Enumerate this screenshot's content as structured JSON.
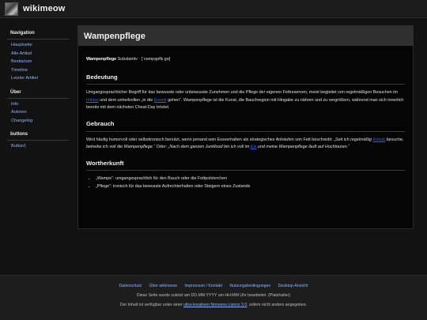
{
  "header": {
    "logo_icon": "cat-logo-icon",
    "site_name": "wikimeow"
  },
  "sidebar": {
    "nav_heading": "Navigation",
    "nav_items": [
      "Hauptseite",
      "Alle Artikel",
      "Bestiarium",
      "Timeline",
      "Letzter Artikel"
    ],
    "about_heading": "Über",
    "about_items": [
      "Info",
      "Autoren",
      "Changelog"
    ],
    "buttons_heading": "buttons",
    "buttons_items": [
      "Button1"
    ]
  },
  "article": {
    "title": "Wampenpflege",
    "lemma": {
      "word": "Wampenpflege",
      "rest": " Substantiv · [ˈvampə̯pflɛːɡə]"
    },
    "bedeutung": {
      "heading": "Bedeutung",
      "t1": "Umgangssprachlicher Begriff für das bewusste oder unbewusste Zunehmen und die Pflege der eigenen Fettreserven, meist begleitet von regelmäßigen Besuchen im ",
      "link1": "Imbiss",
      "t2": " und dem unheilvollen „in die ",
      "link2": "Eiszeit",
      "t3": " gehen“. Wampenpflege ist die Kunst, die Bauchregion mit Hingabe zu nähren und zu vergrößern, während man sich innerlich bereits mit dem nächsten Cheat-Day tröstet."
    },
    "gebrauch": {
      "heading": "Gebrauch",
      "t1": "Wird häufig humorvoll oder selbstironisch benutzt, wenn jemand sein Essverhalten als strategisches Anhäufen von Fett beschreibt: ",
      "q1a": "„Seit ich regelmäßig ",
      "link1": "Kebab",
      "q1b": " besuche, betreibe ich voll die Wampenpflege.“",
      "t2": " Oder: ",
      "q2a": "„Nach dem ganzen Junkfood bin ich voll im ",
      "link2": "Eis",
      "q2b": " und meine Wampenpflege läuft auf Hochtouren.“"
    },
    "wortherkunft": {
      "heading": "Wortherkunft",
      "items": [
        "„Wampe“: umgangssprachlich für den Bauch oder die Fettpolsterchen",
        "„Pflege“: ironisch für das bewusste Aufrechterhalten oder Steigern eines Zustands"
      ]
    }
  },
  "footer": {
    "links": [
      "Datenschutz",
      "Über wikimeow",
      "Impressum / Kontakt",
      "Nutzungsbedingungen",
      "Desktop-Ansicht"
    ],
    "edited": "Diese Seite wurde zuletzt am DD.MM.YYYY um HH:MM Uhr bearbeitet. (Platzhalter)",
    "license_pre": "Der Inhalt ist verfügbar unter einer ",
    "license_link": "ultra-kreativen Nonsens-Lizenz 3.0",
    "license_post": ", sofern nicht anders angegeben."
  }
}
